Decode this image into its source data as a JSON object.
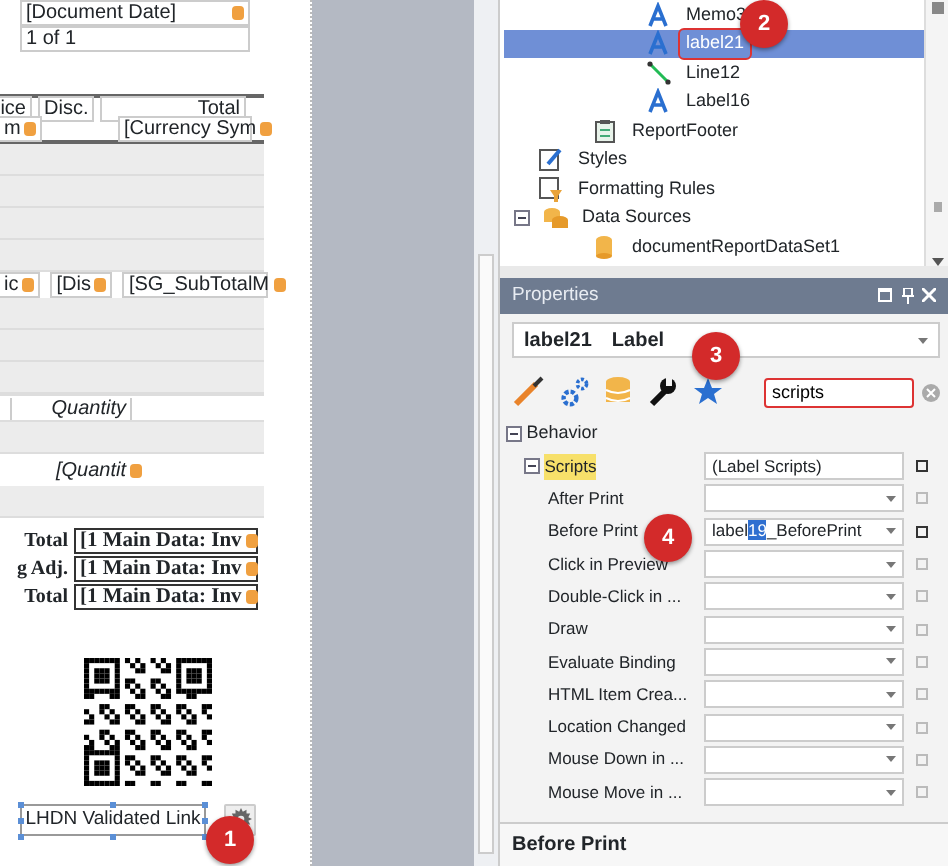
{
  "designer": {
    "date_field": "[Document Date]",
    "page_field": "1 of 1",
    "header_cells": [
      "ice",
      "Disc.",
      "Total"
    ],
    "currency_row": [
      "m",
      "[Currency Sym"
    ],
    "subtotal_row": [
      "ic",
      "[Dis",
      "[SG_SubTotalM"
    ],
    "quantity_header": "Quantity",
    "quantity_field": "[Quantit",
    "totals": [
      {
        "label": "Total",
        "value": "[1 Main Data:  Inv"
      },
      {
        "label": "g Adj.",
        "value": "[1 Main Data:  Inv"
      },
      {
        "label": "Total",
        "value": "[1 Main Data:  Inv"
      }
    ],
    "link_label": {
      "text": "LHDN Validated Link",
      "selected": true
    }
  },
  "callouts": [
    "1",
    "2",
    "3",
    "4"
  ],
  "tree": [
    {
      "children": [
        {
          "children": [
            {
              "label": "Memo3",
              "kind": "label",
              "selected": false,
              "outlined": false
            },
            {
              "label": "label21",
              "kind": "label",
              "selected": true,
              "outlined": true
            },
            {
              "label": "Line12",
              "kind": "line",
              "selected": false,
              "outlined": false
            },
            {
              "label": "Label16",
              "kind": "label",
              "selected": false,
              "outlined": false
            }
          ]
        },
        {
          "label": "ReportFooter",
          "kind": "band",
          "selected": false,
          "outlined": false
        }
      ]
    },
    {
      "label": "Styles",
      "kind": "styles",
      "selected": false,
      "outlined": false
    },
    {
      "label": "Formatting Rules",
      "kind": "rules",
      "selected": false,
      "outlined": false
    },
    {
      "label": "Data Sources",
      "kind": "sources",
      "selected": false,
      "outlined": false,
      "expanded": true,
      "children": [
        {
          "label": "documentReportDataSet1",
          "kind": "dataset",
          "selected": false,
          "outlined": false
        }
      ]
    }
  ],
  "properties": {
    "title": "Properties",
    "object_name": "label21",
    "object_type": "Label",
    "search": {
      "value": "scripts"
    },
    "category": {
      "label": "Behavior",
      "expanded": true
    },
    "group": {
      "label": "Scripts",
      "value": "(Label Scripts)",
      "expanded": true,
      "modified": true
    },
    "rows": [
      {
        "name": "After Print",
        "value": "",
        "modified": false
      },
      {
        "name": "Before Print",
        "value_start": "label",
        "value_selected": "19",
        "value_end": "_BeforePrint",
        "modified": true
      },
      {
        "name": "Click in Preview",
        "value": "",
        "modified": false
      },
      {
        "name": "Double-Click in ...",
        "value": "",
        "modified": false
      },
      {
        "name": "Draw",
        "value": "",
        "modified": false
      },
      {
        "name": "Evaluate Binding",
        "value": "",
        "modified": false
      },
      {
        "name": "HTML Item Crea...",
        "value": "",
        "modified": false
      },
      {
        "name": "Location Changed",
        "value": "",
        "modified": false
      },
      {
        "name": "Mouse Down in ...",
        "value": "",
        "modified": false
      },
      {
        "name": "Mouse Move in ...",
        "value": "",
        "modified": false
      }
    ],
    "description": "Before Print"
  }
}
